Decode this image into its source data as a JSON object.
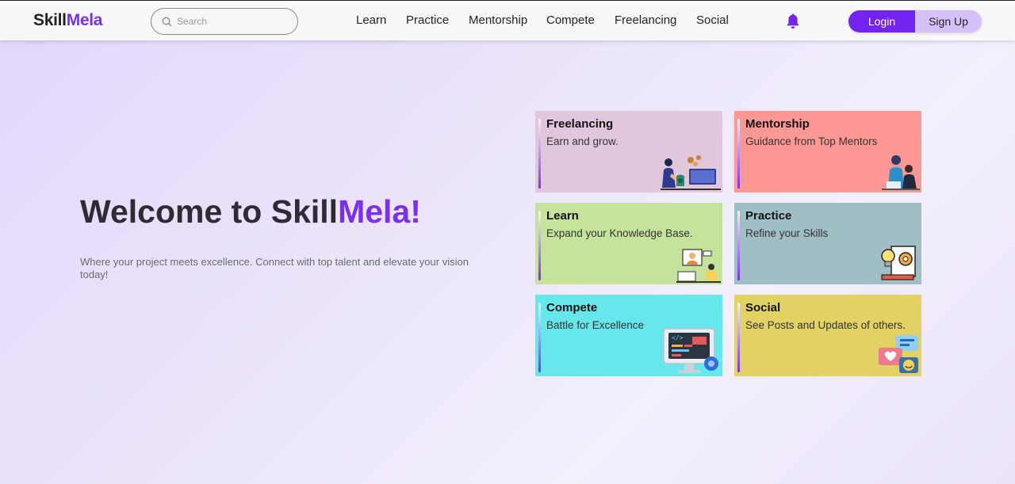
{
  "brand": {
    "part1": "Skill",
    "part2": "Mela"
  },
  "search": {
    "placeholder": "Search"
  },
  "nav": [
    {
      "label": "Learn"
    },
    {
      "label": "Practice"
    },
    {
      "label": "Mentorship"
    },
    {
      "label": "Compete"
    },
    {
      "label": "Freelancing"
    },
    {
      "label": "Social"
    }
  ],
  "auth": {
    "login": "Login",
    "signup": "Sign Up"
  },
  "hero": {
    "title_prefix": "Welcome to Skill",
    "title_accent": "Mela!",
    "subtitle": "Where your project meets excellence. Connect with top talent and elevate your vision today!"
  },
  "cards": [
    {
      "title": "Freelancing",
      "desc": "Earn and grow.",
      "color": "#e2c6dc",
      "icon": "freelancer-money-icon"
    },
    {
      "title": "Mentorship",
      "desc": "Guidance from Top Mentors",
      "color": "#fe9894",
      "icon": "mentor-meeting-icon"
    },
    {
      "title": "Learn",
      "desc": "Expand your Knowledge Base.",
      "color": "#c6e39c",
      "icon": "video-class-icon"
    },
    {
      "title": "Practice",
      "desc": "Refine your Skills",
      "color": "#9fbfc4",
      "icon": "lightbulb-gear-icon"
    },
    {
      "title": "Compete",
      "desc": "Battle for Excellence",
      "color": "#66e7ec",
      "icon": "code-monitor-icon"
    },
    {
      "title": "Social",
      "desc": "See Posts and Updates of others.",
      "color": "#e2d264",
      "icon": "chat-heart-icon"
    }
  ],
  "colors": {
    "accent": "#7424f0",
    "accent_light": "#d4c1f7"
  }
}
